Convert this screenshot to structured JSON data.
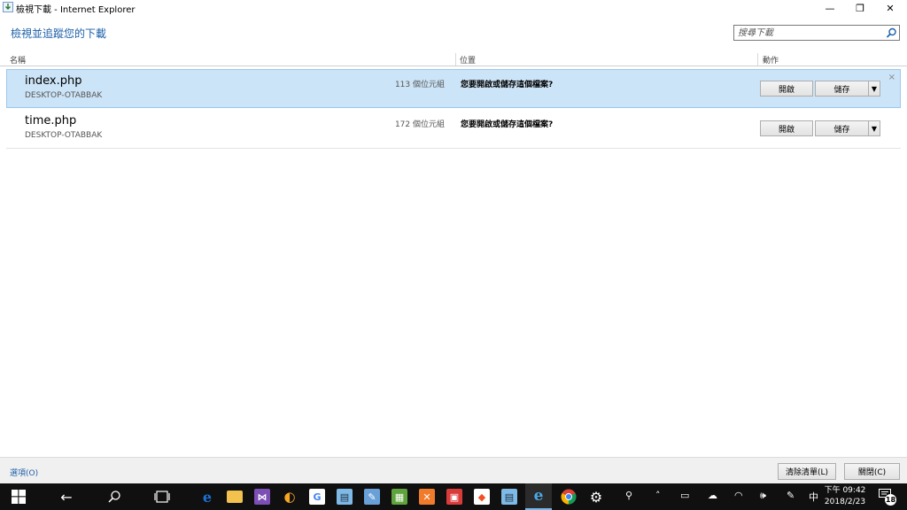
{
  "window": {
    "title": "檢視下載 - Internet Explorer",
    "minimize_glyph": "—",
    "restore_glyph": "❐",
    "close_glyph": "✕"
  },
  "header": {
    "title": "檢視並追蹤您的下載",
    "search_placeholder": "搜尋下載"
  },
  "columns": {
    "name": "名稱",
    "location": "位置",
    "actions": "動作"
  },
  "downloads": [
    {
      "filename": "index.php",
      "host": "DESKTOP-OTABBAK",
      "size": "113 個位元組",
      "prompt": "您要開啟或儲存這個檔案?",
      "open_label": "開啟",
      "save_label": "儲存",
      "dismiss": "×"
    },
    {
      "filename": "time.php",
      "host": "DESKTOP-OTABBAK",
      "size": "172 個位元組",
      "prompt": "您要開啟或儲存這個檔案?",
      "open_label": "開啟",
      "save_label": "儲存"
    }
  ],
  "footer": {
    "options": "選項(O)",
    "clear_list": "清除清單(L)",
    "close": "關閉(C)"
  },
  "taskbar": {
    "apps": [
      {
        "name": "edge-icon",
        "color": "#1a73d9",
        "glyph": "e"
      },
      {
        "name": "file-explorer-icon",
        "color": "#f2c14e",
        "glyph": ""
      },
      {
        "name": "visual-studio-icon",
        "color": "#7b4fb5",
        "glyph": "⋈"
      },
      {
        "name": "app-circle-icon",
        "color": "#f5a623",
        "glyph": "◐"
      },
      {
        "name": "google-icon",
        "color": "#ffffff",
        "glyph": "G"
      },
      {
        "name": "notepad-icon",
        "color": "#7fb9e6",
        "glyph": "▤"
      },
      {
        "name": "paint-icon",
        "color": "#6aa0d8",
        "glyph": "✎"
      },
      {
        "name": "editor-icon",
        "color": "#5ea33b",
        "glyph": "▦"
      },
      {
        "name": "xampp-icon",
        "color": "#f07b2b",
        "glyph": "✕"
      },
      {
        "name": "media-icon",
        "color": "#d93b3b",
        "glyph": "▣"
      },
      {
        "name": "store-icon",
        "color": "#ffffff",
        "glyph": "◆"
      },
      {
        "name": "notepad2-icon",
        "color": "#7fb9e6",
        "glyph": "▤"
      },
      {
        "name": "internet-explorer-icon",
        "color": "#4aa8e8",
        "glyph": "e"
      },
      {
        "name": "chrome-icon",
        "color": "#f1b72f",
        "glyph": "●"
      },
      {
        "name": "settings-icon",
        "color": "#ffffff",
        "glyph": "⚙"
      }
    ],
    "ime": "中",
    "time": "下午 09:42",
    "date": "2018/2/23",
    "notification_count": "18"
  }
}
